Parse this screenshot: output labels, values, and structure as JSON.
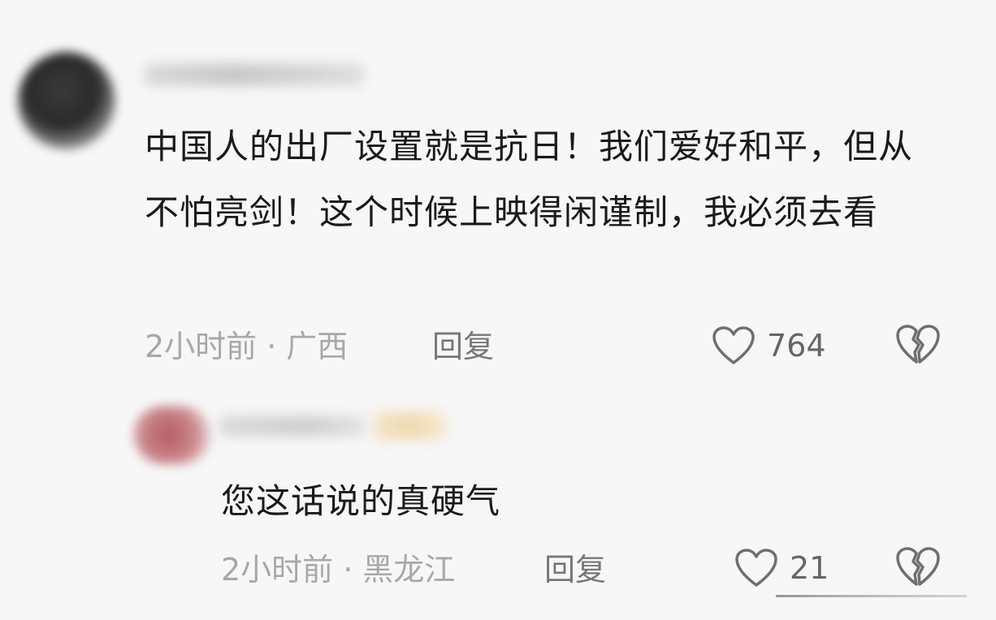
{
  "comments": [
    {
      "text": "中国人的出厂设置就是抗日！我们爱好和平，但从不怕亮剑！这个时候上映得闲谨制，我必须去看",
      "time": "2小时前",
      "separator": "·",
      "location": "广西",
      "reply_label": "回复",
      "likes": "764",
      "icons": {
        "like": "heart-outline-icon",
        "dislike": "broken-heart-icon"
      }
    },
    {
      "text": "您这话说的真硬气",
      "time": "2小时前",
      "separator": "·",
      "location": "黑龙江",
      "reply_label": "回复",
      "likes": "21",
      "icons": {
        "like": "heart-outline-icon",
        "dislike": "broken-heart-icon"
      }
    }
  ],
  "colors": {
    "background": "#f7f7f7",
    "text": "#1a1a1a",
    "meta": "#a8a8a8",
    "action": "#777777"
  }
}
